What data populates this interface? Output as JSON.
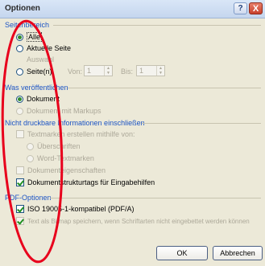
{
  "window": {
    "title": "Optionen",
    "help_label": "?",
    "close_label": "X"
  },
  "page_range": {
    "heading": "Seitenbereich",
    "all": "Alle",
    "current_page": "Aktuelle Seite",
    "selection": "Auswahl",
    "pages": "Seite(n)",
    "from_label": "Von:",
    "from_value": "1",
    "to_label": "Bis:",
    "to_value": "1",
    "selected": "all"
  },
  "publish_what": {
    "heading": "Was veröffentlichen",
    "document": "Dokument",
    "document_with_markup": "Dokument mit Markups",
    "selected": "document"
  },
  "non_printing": {
    "heading": "Nicht druckbare Informationen einschließen",
    "create_bookmarks": "Textmarken erstellen mithilfe von:",
    "headings": "Überschriften",
    "word_bookmarks": "Word-Textmarken",
    "document_properties": "Dokumenteigenschaften",
    "structure_tags": "Dokumentstrukturtags für Eingabehilfen",
    "structure_tags_checked": true
  },
  "pdf_options": {
    "heading": "PDF-Optionen",
    "iso": "ISO 19005-1-kompatibel (PDF/A)",
    "iso_checked": true,
    "bitmap_text": "Text als Bitmap speichern, wenn Schriftarten nicht eingebettet werden können"
  },
  "buttons": {
    "ok": "OK",
    "cancel": "Abbrechen"
  },
  "colors": {
    "section_heading": "#1c54c4",
    "annotation": "#e8001c"
  }
}
